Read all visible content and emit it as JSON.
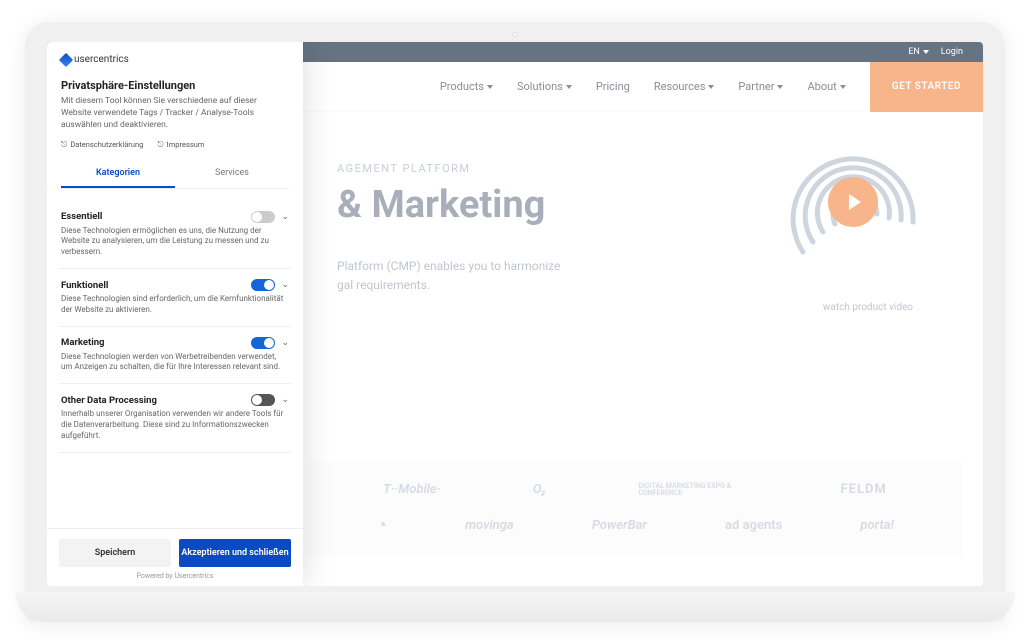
{
  "topbar": {
    "lang": "EN",
    "login": "Login"
  },
  "nav": {
    "items": [
      "Products",
      "Solutions",
      "Pricing",
      "Resources",
      "Partner",
      "About"
    ],
    "cta": "GET STARTED"
  },
  "hero": {
    "eyebrow": "AGEMENT PLATFORM",
    "title": "& Marketing",
    "sub1": "Platform (CMP) enables you to harmonize",
    "sub2": "gal requirements.",
    "video_caption": "watch product video"
  },
  "logos": {
    "row1": [
      "T··Mobile·",
      "O₂",
      "DIGITAL MARKETING EXPO & CONFERENCE",
      "FELDM"
    ],
    "row2": [
      "◔",
      "movinga",
      "PowerBar",
      "ad agents",
      "porta!"
    ]
  },
  "panel": {
    "brand": "usercentrics",
    "title": "Privatsphäre-Einstellungen",
    "desc": "Mit diesem Tool können Sie verschiedene auf dieser Website verwendete Tags / Tracker / Analyse-Tools auswählen und deaktivieren.",
    "links": {
      "privacy": "Datenschutzerklärung",
      "imprint": "Impressum"
    },
    "tabs": {
      "categories": "Kategorien",
      "services": "Services"
    },
    "categories": [
      {
        "title": "Essentiell",
        "desc": "Diese Technologien ermöglichen es uns, die Nutzung der Website zu analysieren, um die Leistung zu messen und zu verbessern.",
        "state": "disabled"
      },
      {
        "title": "Funktionell",
        "desc": "Diese Technologien sind erforderlich, um die Kernfunktionalität der Website zu aktivieren.",
        "state": "on"
      },
      {
        "title": "Marketing",
        "desc": "Diese Technologien werden von Werbetreibenden verwendet, um Anzeigen zu schalten, die für Ihre Interessen relevant sind.",
        "state": "on"
      },
      {
        "title": "Other Data Processing",
        "desc": "Innerhalb unserer Organisation verwenden wir andere Tools für die Datenverarbeitung. Diese sind zu Informationszwecken aufgeführt.",
        "state": "off"
      }
    ],
    "save": "Speichern",
    "accept": "Akzeptieren und schließen",
    "powered": "Powered by Usercentrics"
  }
}
